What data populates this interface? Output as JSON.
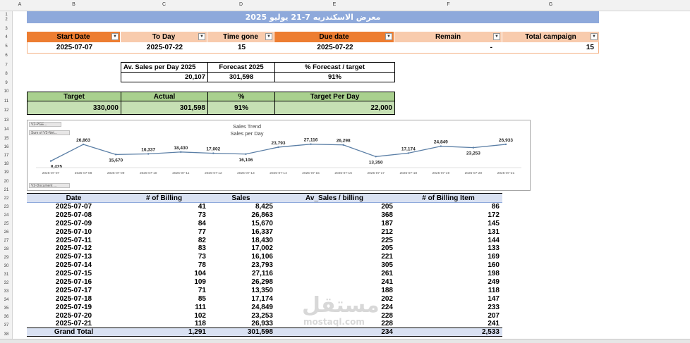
{
  "columns": [
    "A",
    "B",
    "C",
    "D",
    "E",
    "F",
    "G"
  ],
  "rows": [
    "1",
    "2",
    "3",
    "4",
    "5",
    "6",
    "7",
    "8",
    "9",
    "10",
    "11",
    "12",
    "13",
    "14",
    "15",
    "16",
    "17",
    "18",
    "19",
    "20",
    "21",
    "22",
    "23",
    "24",
    "25",
    "26",
    "27",
    "28",
    "29",
    "30",
    "31",
    "32",
    "33",
    "34",
    "35",
    "36",
    "37",
    "38"
  ],
  "title": "معرض الاسكندريه 7-21 يوليو 2025",
  "summary": {
    "headers": [
      "Start Date",
      "To Day",
      "Time gone",
      "Due date",
      "Remain",
      "Total campaign"
    ],
    "values": [
      "2025-07-07",
      "2025-07-22",
      "15",
      "2025-07-22",
      "-",
      "15"
    ]
  },
  "forecast": {
    "h1": "Av. Sales per Day 2025",
    "h2": "Forecast 2025",
    "h3": "% Forecast / target",
    "v1": "20,107",
    "v2": "301,598",
    "v3": "91%"
  },
  "target": {
    "h1": "Target",
    "h2": "Actual",
    "h3": "%",
    "h4": "Target Per Day",
    "v1": "330,000",
    "v2": "301,598",
    "v3": "91%",
    "v4": "22,000"
  },
  "chart_filters": {
    "f1": "V2-PGE...",
    "f2": "Sum of V2-Net...",
    "f3": "V2-Document ..."
  },
  "chart_data": {
    "type": "line",
    "title": "Sales Trend",
    "subtitle": "Sales per Day",
    "categories": [
      "2025-07-07",
      "2025-07-08",
      "2025-07-09",
      "2025-07-10",
      "2025-07-11",
      "2025-07-12",
      "2025-07-13",
      "2025-07-14",
      "2025-07-15",
      "2025-07-16",
      "2025-07-17",
      "2025-07-18",
      "2025-07-19",
      "2025-07-20",
      "2025-07-21"
    ],
    "values": [
      8425,
      26863,
      15670,
      16337,
      18430,
      17002,
      16106,
      23793,
      27116,
      26298,
      13350,
      17174,
      24849,
      23253,
      26933
    ],
    "labels": [
      "8,425",
      "26,863",
      "15,670",
      "16,337",
      "18,430",
      "17,002",
      "16,106",
      "23,793",
      "27,116",
      "26,298",
      "13,350",
      "17,174",
      "24,849",
      "23,253",
      "26,933"
    ],
    "color": "#5b7fa6"
  },
  "table": {
    "headers": [
      "Date",
      "# of Billing",
      "Sales",
      "Av_Sales / billing",
      "# of Billing Item"
    ],
    "rows": [
      [
        "2025-07-07",
        "41",
        "8,425",
        "205",
        "86"
      ],
      [
        "2025-07-08",
        "73",
        "26,863",
        "368",
        "172"
      ],
      [
        "2025-07-09",
        "84",
        "15,670",
        "187",
        "145"
      ],
      [
        "2025-07-10",
        "77",
        "16,337",
        "212",
        "131"
      ],
      [
        "2025-07-11",
        "82",
        "18,430",
        "225",
        "144"
      ],
      [
        "2025-07-12",
        "83",
        "17,002",
        "205",
        "133"
      ],
      [
        "2025-07-13",
        "73",
        "16,106",
        "221",
        "169"
      ],
      [
        "2025-07-14",
        "78",
        "23,793",
        "305",
        "160"
      ],
      [
        "2025-07-15",
        "104",
        "27,116",
        "261",
        "198"
      ],
      [
        "2025-07-16",
        "109",
        "26,298",
        "241",
        "249"
      ],
      [
        "2025-07-17",
        "71",
        "13,350",
        "188",
        "118"
      ],
      [
        "2025-07-18",
        "85",
        "17,174",
        "202",
        "147"
      ],
      [
        "2025-07-19",
        "111",
        "24,849",
        "224",
        "233"
      ],
      [
        "2025-07-20",
        "102",
        "23,253",
        "228",
        "207"
      ],
      [
        "2025-07-21",
        "118",
        "26,933",
        "228",
        "241"
      ]
    ],
    "total": [
      "Grand Total",
      "1,291",
      "301,598",
      "234",
      "2,533"
    ]
  },
  "watermark": {
    "ar": "مستقل",
    "en": "mostaql.com"
  },
  "colors": {
    "orange": "#ed7d31",
    "peach": "#f8cbad",
    "blue_header": "#8ea9db",
    "green": "#a9d08e",
    "light_green": "#c6e0b4",
    "table_header": "#d9e1f2"
  }
}
